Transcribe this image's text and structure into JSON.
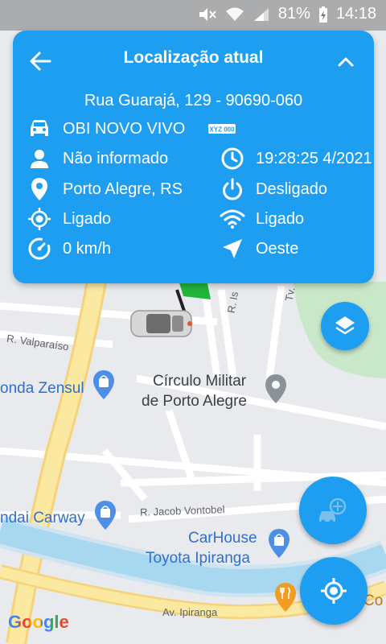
{
  "status_bar": {
    "battery": "81%",
    "time": "14:18"
  },
  "card": {
    "title": "Localização atual",
    "address": "Rua Guarajá, 129 - 90690-060",
    "rows_left": [
      {
        "icon": "car-icon",
        "value": "OBI NOVO VIVO"
      },
      {
        "icon": "person-icon",
        "value": "Não informado"
      },
      {
        "icon": "location-pin-icon",
        "value": "Porto Alegre, RS"
      },
      {
        "icon": "gps-crosshair-icon",
        "value": "Ligado"
      },
      {
        "icon": "speedometer-icon",
        "value": "0 km/h"
      }
    ],
    "rows_right": [
      {
        "icon": "license-plate-icon",
        "value": "XYZ 000"
      },
      {
        "icon": "clock-icon",
        "value": "4/2021 19:28:25"
      },
      {
        "icon": "power-icon",
        "value": "Desligado"
      },
      {
        "icon": "wifi-icon",
        "value": "Ligado"
      },
      {
        "icon": "navigation-arrow-icon",
        "value": "Oeste"
      }
    ]
  },
  "map": {
    "labels": {
      "circulo_line1": "Círculo Militar",
      "circulo_line2": "de Porto Alegre",
      "honda": "onda Zensul",
      "hyundai": "ndai Carway",
      "carhouse_line1": "CarHouse",
      "carhouse_line2": "Toyota Ipiranga",
      "co": "Co"
    },
    "streets": {
      "valparaiso": "R. Valparaíso",
      "jacob": "R. Jacob Vontobel",
      "ipiranga": "Av. Ipiranga",
      "r_is": "R. Is",
      "tv": "Tv."
    },
    "attribution": "Google",
    "colors": {
      "map_bg": "#e8eaed",
      "road_major": "#fbe9a2",
      "river": "#a8d8f0",
      "park": "#c9e7c9",
      "accent": "#1e9ef0",
      "poi_blue": "#4d8fe6",
      "poi_orange": "#f19c22",
      "poi_gray": "#8a9299"
    }
  }
}
